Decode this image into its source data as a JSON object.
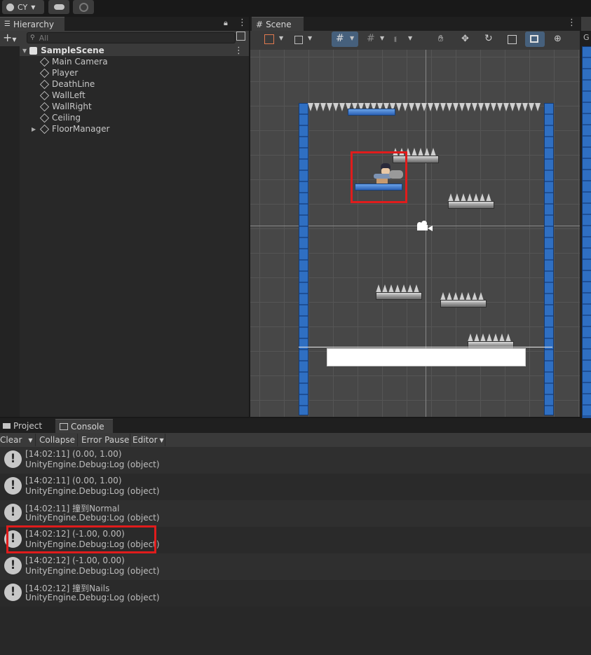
{
  "topbar": {
    "account_label": "CY"
  },
  "hierarchy": {
    "tab_label": "Hierarchy",
    "search_placeholder": "All",
    "scene_name": "SampleScene",
    "items": [
      {
        "label": "Main Camera"
      },
      {
        "label": "Player"
      },
      {
        "label": "DeathLine"
      },
      {
        "label": "WallLeft"
      },
      {
        "label": "WallRight"
      },
      {
        "label": "Ceiling"
      },
      {
        "label": "FloorManager"
      }
    ]
  },
  "scene": {
    "tab_label": "Scene",
    "right_tab_fragment": "G"
  },
  "bottom": {
    "project_tab": "Project",
    "console_tab": "Console",
    "toolbar": {
      "clear": "Clear",
      "collapse": "Collapse",
      "error_pause": "Error Pause",
      "editor": "Editor"
    },
    "logs": [
      {
        "line1": "[14:02:11] (0.00, 1.00)",
        "line2": "UnityEngine.Debug:Log (object)"
      },
      {
        "line1": "[14:02:11] (0.00, 1.00)",
        "line2": "UnityEngine.Debug:Log (object)"
      },
      {
        "line1": "[14:02:11] 撞到Normal",
        "line2": "UnityEngine.Debug:Log (object)"
      },
      {
        "line1": "[14:02:12] (-1.00, 0.00)",
        "line2": "UnityEngine.Debug:Log (object)"
      },
      {
        "line1": "[14:02:12] (-1.00, 0.00)",
        "line2": "UnityEngine.Debug:Log (object)"
      },
      {
        "line1": "[14:02:12] 撞到Nails",
        "line2": "UnityEngine.Debug:Log (object)"
      }
    ]
  },
  "colors": {
    "highlight": "#e01c1c",
    "selection_blue": "#46607c",
    "wall_blue": "#2f6fc2"
  }
}
